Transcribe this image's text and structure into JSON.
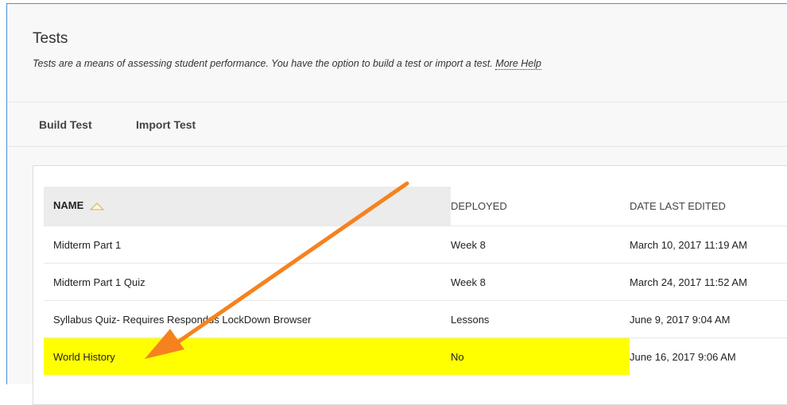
{
  "header": {
    "title": "Tests",
    "description": "Tests are a means of assessing student performance. You have the option to build a test or import a test.",
    "more_help": "More Help"
  },
  "toolbar": {
    "build_test": "Build Test",
    "import_test": "Import Test"
  },
  "table": {
    "columns": {
      "name": "NAME",
      "deployed": "DEPLOYED",
      "date_last_edited": "DATE LAST EDITED"
    },
    "sort": "ascending",
    "rows": [
      {
        "name": "Midterm Part 1",
        "deployed": "Week 8",
        "date": "March 10, 2017 11:19 AM"
      },
      {
        "name": "Midterm Part 1 Quiz",
        "deployed": "Week 8",
        "date": "March 24, 2017 11:52 AM"
      },
      {
        "name": "Syllabus Quiz- Requires Respondus LockDown Browser",
        "deployed": "Lessons",
        "date": "June 9, 2017 9:04 AM"
      },
      {
        "name": "World History",
        "deployed": "No",
        "date": "June 16, 2017 9:06 AM",
        "highlighted": true
      }
    ]
  },
  "annotation": {
    "arrow_color": "#f5821f",
    "points_to": "World History"
  },
  "colors": {
    "highlight": "#ffff00",
    "frame_border": "#4a90d9"
  }
}
